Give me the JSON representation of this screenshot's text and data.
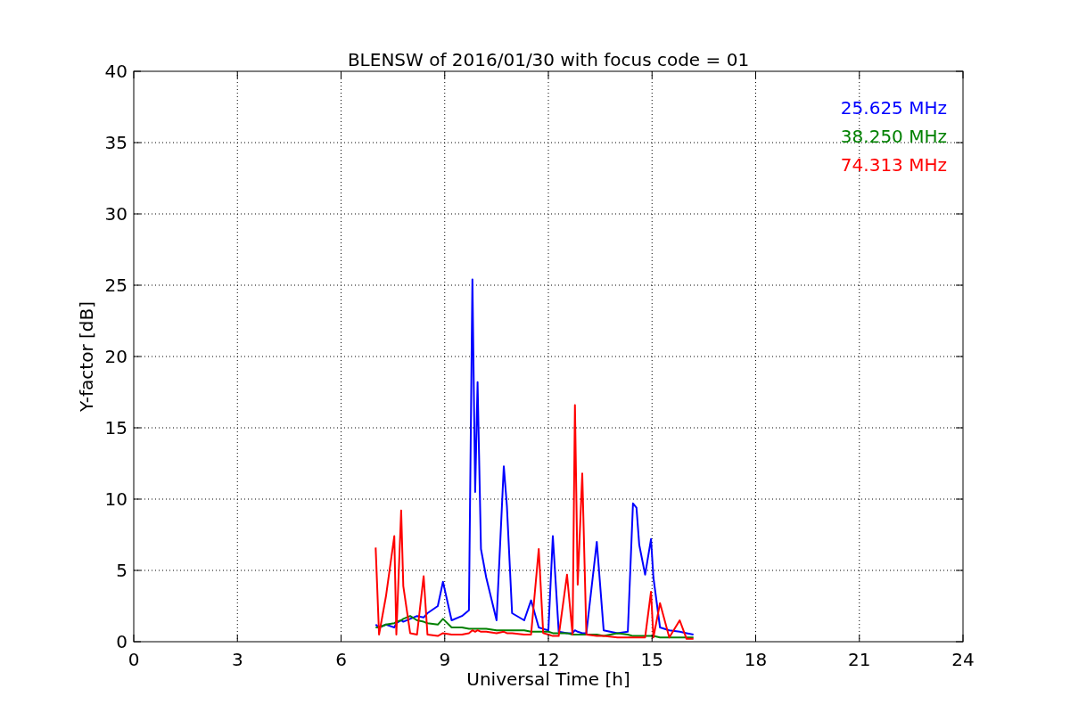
{
  "figure": {
    "chart_data": {
      "type": "line",
      "title": "BLENSW of 2016/01/30 with focus code = 01",
      "xlabel": "Universal Time [h]",
      "ylabel": "Y-factor [dB]",
      "xlim": [
        0,
        24
      ],
      "ylim": [
        0,
        40
      ],
      "xticks": [
        0,
        3,
        6,
        9,
        12,
        15,
        18,
        21,
        24
      ],
      "yticks": [
        0,
        5,
        10,
        15,
        20,
        25,
        30,
        35,
        40
      ],
      "grid": true,
      "x": [
        7.0,
        7.1,
        7.3,
        7.54,
        7.6,
        7.74,
        7.8,
        8.0,
        8.2,
        8.39,
        8.5,
        8.8,
        8.95,
        9.2,
        9.5,
        9.7,
        9.8,
        9.88,
        9.95,
        10.05,
        10.2,
        10.5,
        10.71,
        10.8,
        10.95,
        11.3,
        11.5,
        11.72,
        11.85,
        12.0,
        12.13,
        12.3,
        12.54,
        12.7,
        12.77,
        12.85,
        12.98,
        13.1,
        13.4,
        13.6,
        14.0,
        14.3,
        14.45,
        14.55,
        14.63,
        14.8,
        14.97,
        15.04,
        15.23,
        15.5,
        15.8,
        16.0,
        16.2
      ],
      "series": [
        {
          "name": "25.625 MHz",
          "color": "#0000ff",
          "values": [
            1.2,
            1.0,
            1.2,
            1.0,
            1.3,
            1.5,
            1.4,
            1.6,
            1.8,
            1.7,
            2.0,
            2.5,
            4.2,
            1.5,
            1.8,
            2.2,
            25.4,
            10.5,
            18.2,
            6.5,
            4.5,
            1.5,
            12.3,
            9.5,
            2.0,
            1.5,
            2.9,
            1.0,
            0.9,
            0.8,
            7.4,
            0.7,
            0.6,
            0.6,
            0.8,
            0.7,
            0.6,
            0.6,
            7.0,
            0.8,
            0.6,
            0.7,
            9.7,
            9.4,
            6.8,
            4.7,
            7.2,
            4.5,
            1.0,
            0.8,
            0.7,
            0.6,
            0.5
          ]
        },
        {
          "name": "38.250 MHz",
          "color": "#008000",
          "values": [
            1.0,
            1.0,
            1.2,
            1.3,
            1.4,
            1.5,
            1.6,
            1.8,
            1.5,
            1.4,
            1.3,
            1.2,
            1.6,
            1.0,
            1.0,
            0.9,
            0.9,
            0.9,
            0.9,
            0.9,
            0.9,
            0.8,
            0.8,
            0.8,
            0.8,
            0.8,
            0.7,
            0.7,
            0.7,
            0.7,
            0.6,
            0.6,
            0.6,
            0.5,
            0.5,
            0.5,
            0.5,
            0.5,
            0.5,
            0.4,
            0.6,
            0.5,
            0.4,
            0.4,
            0.4,
            0.4,
            0.4,
            0.4,
            0.3,
            0.3,
            0.3,
            0.3,
            0.3
          ]
        },
        {
          "name": "74.313 MHz",
          "color": "#ff0000",
          "values": [
            6.6,
            0.5,
            3.2,
            7.4,
            0.5,
            9.2,
            3.9,
            0.6,
            0.5,
            4.6,
            0.5,
            0.4,
            0.6,
            0.5,
            0.5,
            0.6,
            0.8,
            0.7,
            0.8,
            0.7,
            0.7,
            0.6,
            0.7,
            0.6,
            0.6,
            0.5,
            0.5,
            6.5,
            0.6,
            0.5,
            0.4,
            0.4,
            4.7,
            0.5,
            16.6,
            4.0,
            11.8,
            0.5,
            0.4,
            0.4,
            0.3,
            0.3,
            0.3,
            0.3,
            0.3,
            0.3,
            3.5,
            0.3,
            2.7,
            0.3,
            1.5,
            0.2,
            0.2
          ]
        }
      ]
    }
  }
}
